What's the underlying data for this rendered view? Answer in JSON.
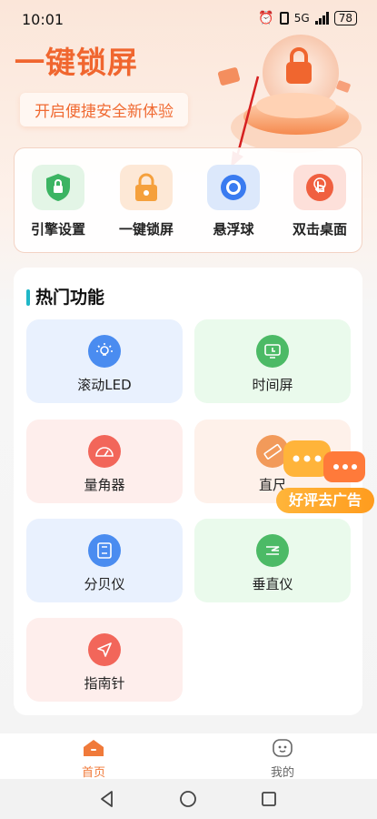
{
  "status": {
    "time": "10:01",
    "network": "5G",
    "battery": "78"
  },
  "hero": {
    "title": "一键锁屏",
    "subtitle": "开启便捷安全新体验"
  },
  "quick_actions": [
    {
      "label": "引擎设置",
      "icon": "shield-lock-icon",
      "color": "#3cb463",
      "bg": "#e3f5e6"
    },
    {
      "label": "一键锁屏",
      "icon": "padlock-icon",
      "color": "#f5a03c",
      "bg": "#fde8d6"
    },
    {
      "label": "悬浮球",
      "icon": "floating-ball-icon",
      "color": "#3a7bf0",
      "bg": "#dce8fb"
    },
    {
      "label": "双击桌面",
      "icon": "double-tap-icon",
      "color": "#f06040",
      "bg": "#fde0da"
    }
  ],
  "hot": {
    "title": "热门功能",
    "tiles": [
      {
        "label": "滚动LED",
        "icon": "bulb-icon",
        "color": "#4a8cf0",
        "bg": "#e9f1fe"
      },
      {
        "label": "时间屏",
        "icon": "clock-screen-icon",
        "color": "#4cba66",
        "bg": "#eafaec"
      },
      {
        "label": "量角器",
        "icon": "protractor-icon",
        "color": "#f2665a",
        "bg": "#feeeec"
      },
      {
        "label": "直尺",
        "icon": "ruler-icon",
        "color": "#f29a5a",
        "bg": "#fef1ea"
      },
      {
        "label": "分贝仪",
        "icon": "decibel-icon",
        "color": "#4a8cf0",
        "bg": "#e9f1fe"
      },
      {
        "label": "垂直仪",
        "icon": "level-icon",
        "color": "#4cba66",
        "bg": "#eafaec"
      },
      {
        "label": "指南针",
        "icon": "compass-icon",
        "color": "#f2665a",
        "bg": "#feeeec"
      }
    ]
  },
  "ad": {
    "label": "好评去广告"
  },
  "tabs": [
    {
      "label": "首页",
      "active": true
    },
    {
      "label": "我的",
      "active": false
    }
  ],
  "colors": {
    "accent": "#f0662f",
    "tab_active": "#f07a3a",
    "tab_inactive": "#666666"
  }
}
